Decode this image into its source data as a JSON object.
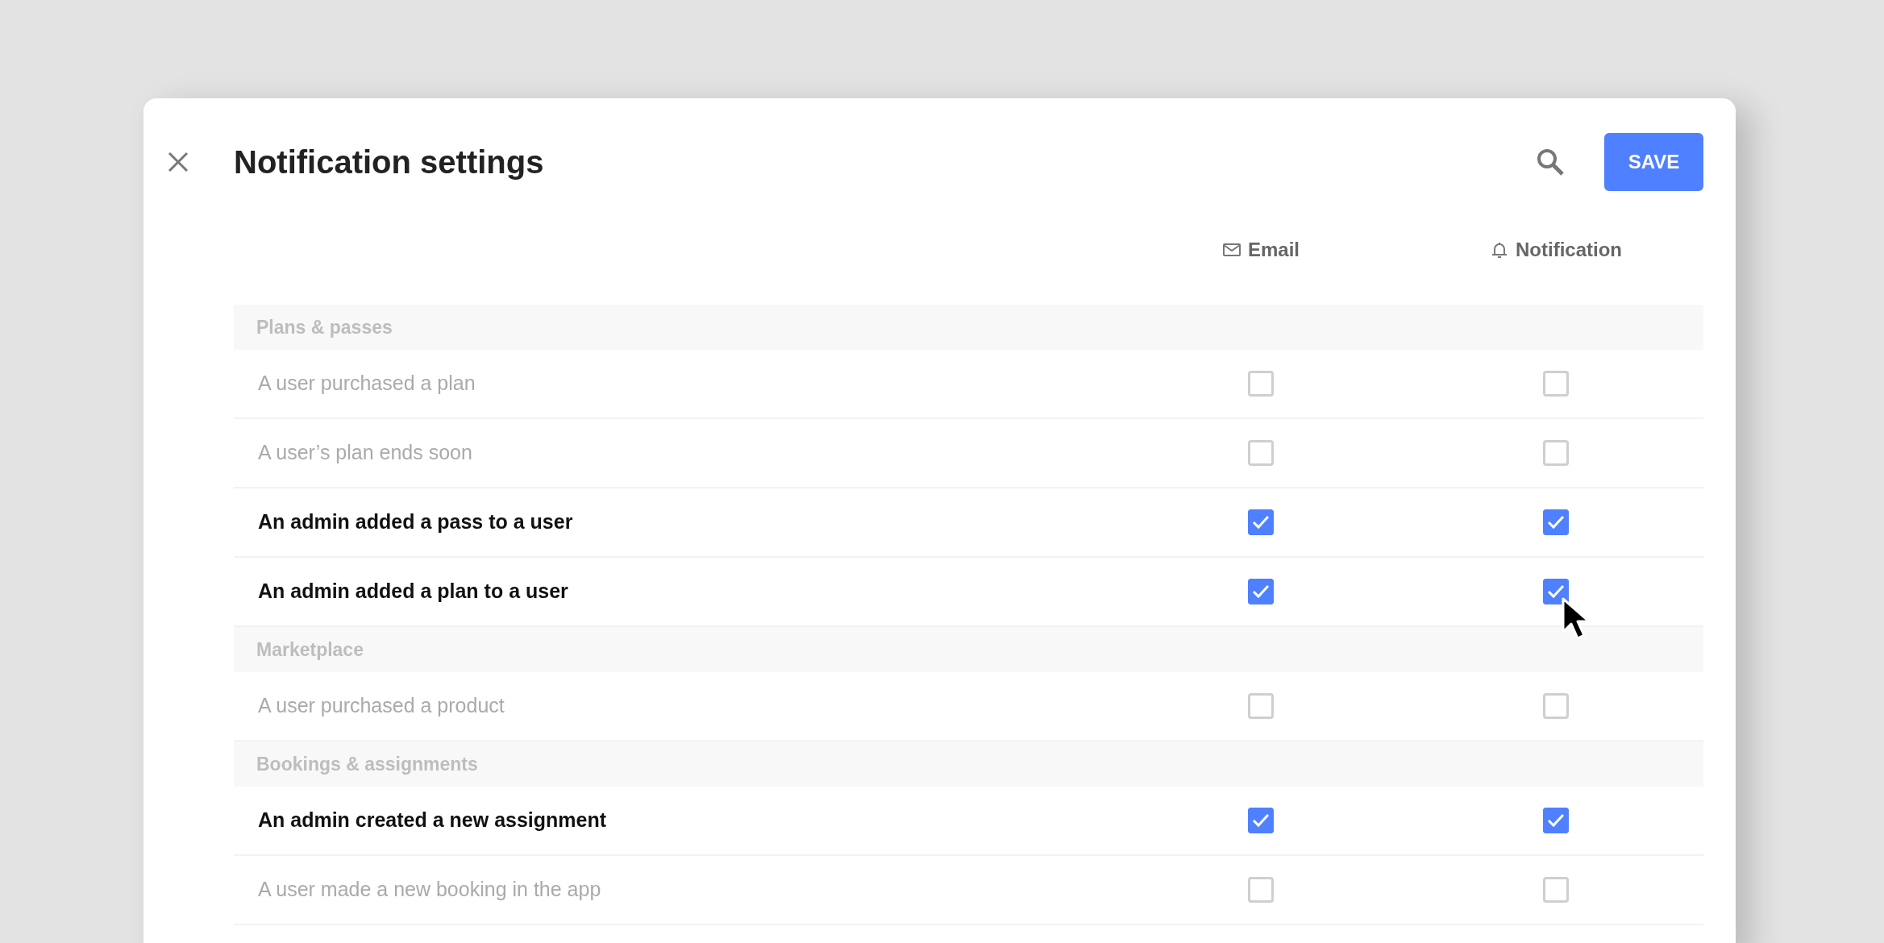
{
  "dialog": {
    "title": "Notification settings",
    "save_button": "SAVE"
  },
  "columns": [
    {
      "kind": "email",
      "label": "Email"
    },
    {
      "kind": "notification",
      "label": "Notification"
    }
  ],
  "sections": [
    {
      "title": "Plans & passes",
      "rows": [
        {
          "label": "A user purchased a plan",
          "email_checked": false,
          "notification_checked": false,
          "hovered": false
        },
        {
          "label": "A user’s plan ends soon",
          "email_checked": false,
          "notification_checked": false,
          "hovered": false
        },
        {
          "label": "An admin added a pass to a user",
          "email_checked": true,
          "notification_checked": true,
          "hovered": false
        },
        {
          "label": "An admin added a plan to a user",
          "email_checked": true,
          "notification_checked": true,
          "hovered": true
        }
      ]
    },
    {
      "title": "Marketplace",
      "rows": [
        {
          "label": "A user purchased a product",
          "email_checked": false,
          "notification_checked": false,
          "hovered": false
        }
      ]
    },
    {
      "title": "Bookings & assignments",
      "rows": [
        {
          "label": "An admin created a new assignment",
          "email_checked": true,
          "notification_checked": true,
          "hovered": false
        },
        {
          "label": "A user made a new booking in the app",
          "email_checked": false,
          "notification_checked": false,
          "hovered": false
        }
      ]
    }
  ]
}
